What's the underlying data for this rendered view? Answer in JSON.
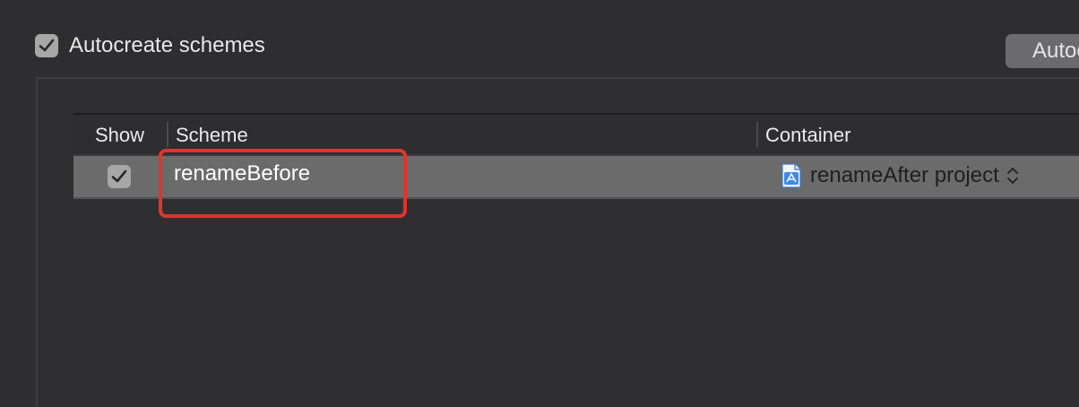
{
  "autocreate": {
    "label": "Autocreate schemes",
    "checked": true
  },
  "top_button": {
    "label": "Autoc"
  },
  "table": {
    "columns": [
      "Show",
      "Scheme",
      "Container"
    ],
    "rows": [
      {
        "show": true,
        "scheme": "renameBefore",
        "container": "renameAfter project"
      }
    ]
  },
  "colors": {
    "highlight": "#e0352b",
    "selected_row": "#6b6b6b"
  },
  "icons": {
    "checkbox": "checkmark-icon",
    "project": "xcode-project-icon",
    "popup": "chevron-updown-icon"
  }
}
